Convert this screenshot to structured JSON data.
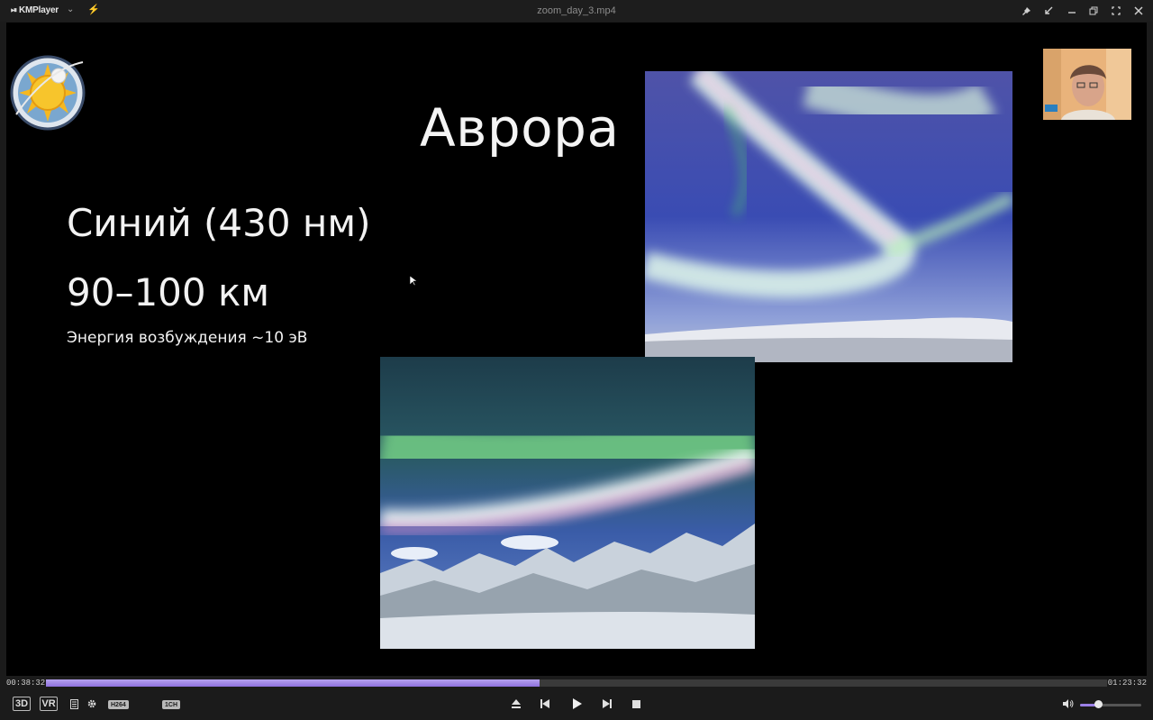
{
  "app": {
    "name": "KMPlayer",
    "file_title": "zoom_day_3.mp4"
  },
  "slide": {
    "title": "Аврора",
    "line1": "Синий (430 нм)",
    "line2": "90–100 км",
    "line3": "Энергия возбуждения ~10 эВ"
  },
  "playback": {
    "current_time": "00:38:32",
    "total_time": "01:23:32",
    "progress_fraction": 0.465,
    "volume_fraction": 0.3
  },
  "badges": {
    "three_d": "3D",
    "vr": "VR",
    "codec": "H264",
    "audio": "1CH"
  },
  "colors": {
    "accent": "#9b80e6",
    "background": "#000000",
    "chrome": "#1b1b1b"
  },
  "icons": {
    "eject": "eject-icon",
    "prev": "previous-icon",
    "play": "play-icon",
    "next": "next-icon",
    "stop": "stop-icon",
    "volume": "speaker-icon"
  }
}
